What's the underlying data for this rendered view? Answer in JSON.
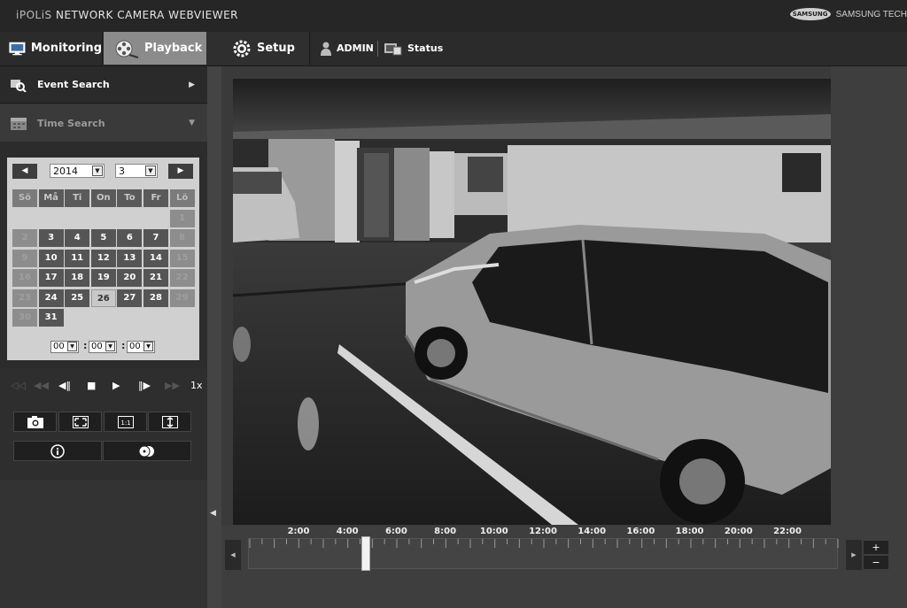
{
  "app": {
    "title_prefix": "iPOLiS",
    "title_rest": " NETWORK CAMERA WEBVIEWER",
    "brand_logo": "SAMSUNG",
    "brand_text": "SAMSUNG TECH"
  },
  "nav": {
    "monitoring": "Monitoring",
    "playback": "Playback",
    "setup": "Setup",
    "user": "ADMIN",
    "status": "Status"
  },
  "sidebar": {
    "event_search": "Event Search",
    "time_search": "Time Search"
  },
  "calendar": {
    "year": "2014",
    "month": "3",
    "weekdays": [
      "Sö",
      "Må",
      "Ti",
      "On",
      "To",
      "Fr",
      "Lö"
    ],
    "weeks": [
      [
        "",
        "",
        "",
        "",
        "",
        "",
        "1"
      ],
      [
        "2",
        "3",
        "4",
        "5",
        "6",
        "7",
        "8"
      ],
      [
        "9",
        "10",
        "11",
        "12",
        "13",
        "14",
        "15"
      ],
      [
        "16",
        "17",
        "18",
        "19",
        "20",
        "21",
        "22"
      ],
      [
        "23",
        "24",
        "25",
        "26",
        "27",
        "28",
        "29"
      ],
      [
        "30",
        "31",
        "",
        "",
        "",
        "",
        ""
      ]
    ],
    "selected_day": "26",
    "hour": "00",
    "minute": "00",
    "second": "00"
  },
  "playback": {
    "speed": "1x"
  },
  "timeline": {
    "labels": [
      "2:00",
      "4:00",
      "6:00",
      "8:00",
      "10:00",
      "12:00",
      "14:00",
      "16:00",
      "18:00",
      "20:00",
      "22:00"
    ],
    "zoom_in": "+",
    "zoom_out": "−"
  },
  "icons": [
    "monitor-icon",
    "film-reel-icon",
    "gear-icon",
    "user-icon",
    "status-icon",
    "event-search-icon",
    "calendar-icon",
    "camera-icon",
    "fit-screen-icon",
    "original-size-icon",
    "fit-height-icon",
    "info-icon",
    "backup-icon"
  ],
  "colors": {
    "active_tab": "#8b8b8b",
    "top_bar": "#262626"
  }
}
